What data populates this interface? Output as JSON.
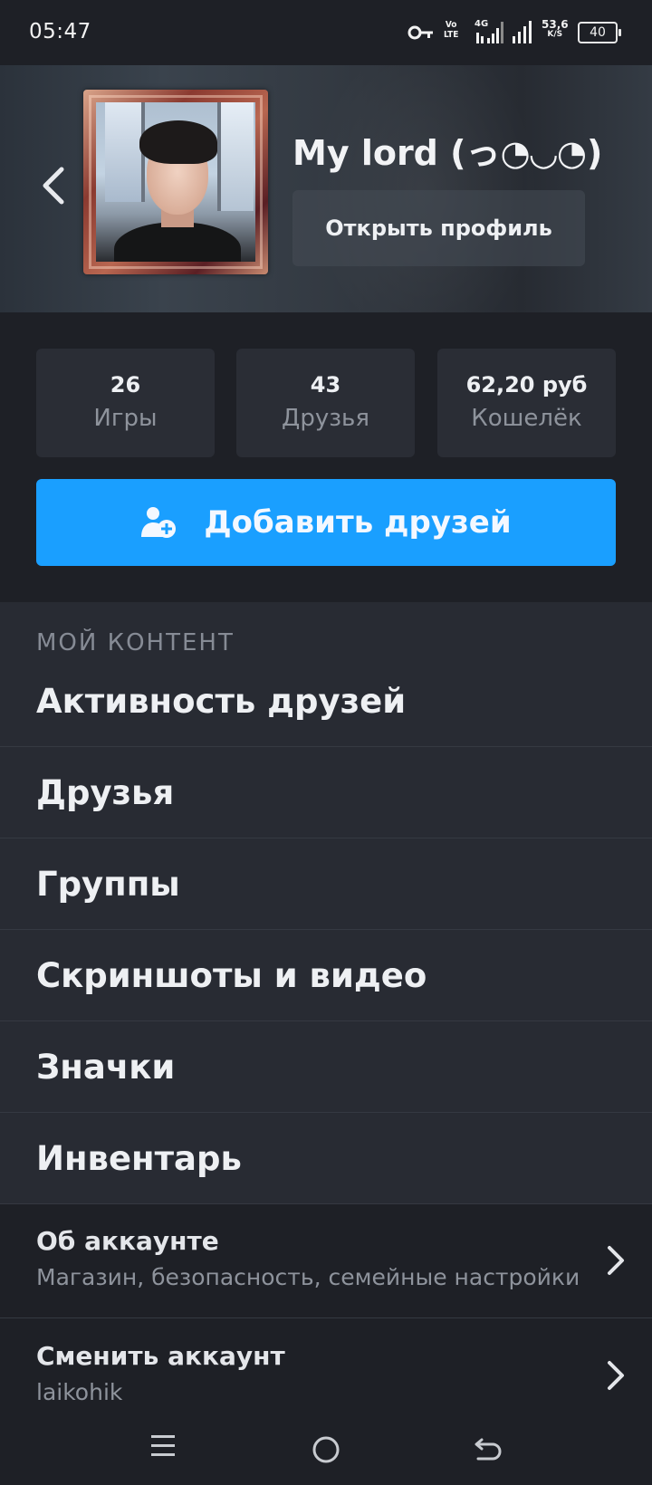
{
  "status_bar": {
    "time": "05:47",
    "volte_top": "Vo",
    "volte_bottom": "LTE",
    "network": "4G",
    "speed_value": "53,6",
    "speed_unit": "K/S",
    "battery": "40"
  },
  "profile": {
    "name": "My lord (っ◔◡◔)",
    "open_profile_label": "Открыть профиль"
  },
  "stats": [
    {
      "value": "26",
      "label": "Игры"
    },
    {
      "value": "43",
      "label": "Друзья"
    },
    {
      "value": "62,20 руб",
      "label": "Кошелёк"
    }
  ],
  "add_friends_label": "Добавить друзей",
  "my_content": {
    "title": "МОЙ КОНТЕНТ",
    "items": [
      "Активность друзей",
      "Друзья",
      "Группы",
      "Скриншоты и видео",
      "Значки",
      "Инвентарь"
    ]
  },
  "account": {
    "title": "Об аккаунте",
    "subtitle": "Магазин, безопасность, семейные настройки"
  },
  "switch_account": {
    "title": "Сменить аккаунт",
    "subtitle": "laikohik"
  },
  "colors": {
    "accent": "#1a9fff",
    "background": "#1e2026",
    "list_background": "#282b33"
  }
}
